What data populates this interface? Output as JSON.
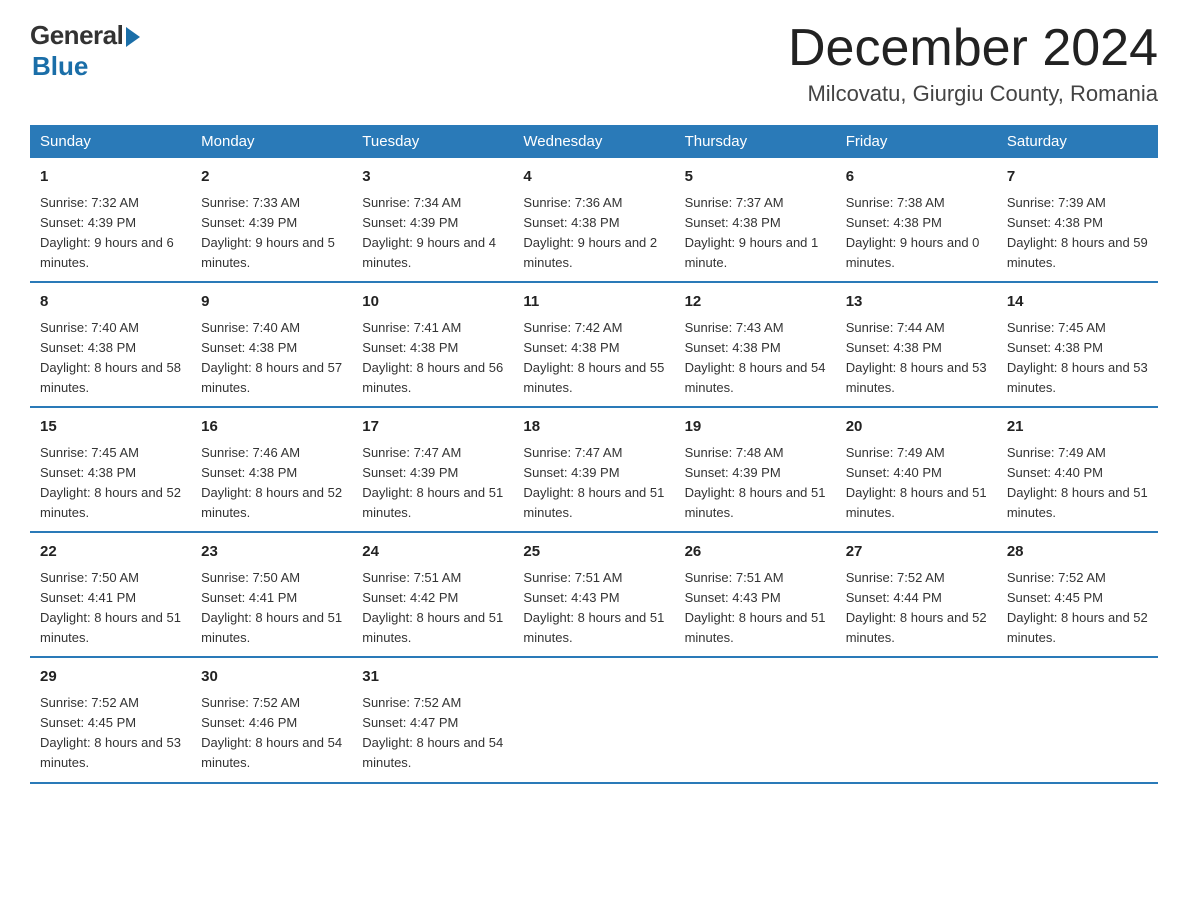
{
  "header": {
    "logo_general": "General",
    "logo_blue": "Blue",
    "month_title": "December 2024",
    "location": "Milcovatu, Giurgiu County, Romania"
  },
  "days_of_week": [
    "Sunday",
    "Monday",
    "Tuesday",
    "Wednesday",
    "Thursday",
    "Friday",
    "Saturday"
  ],
  "weeks": [
    [
      {
        "day": "1",
        "sunrise": "7:32 AM",
        "sunset": "4:39 PM",
        "daylight": "9 hours and 6 minutes."
      },
      {
        "day": "2",
        "sunrise": "7:33 AM",
        "sunset": "4:39 PM",
        "daylight": "9 hours and 5 minutes."
      },
      {
        "day": "3",
        "sunrise": "7:34 AM",
        "sunset": "4:39 PM",
        "daylight": "9 hours and 4 minutes."
      },
      {
        "day": "4",
        "sunrise": "7:36 AM",
        "sunset": "4:38 PM",
        "daylight": "9 hours and 2 minutes."
      },
      {
        "day": "5",
        "sunrise": "7:37 AM",
        "sunset": "4:38 PM",
        "daylight": "9 hours and 1 minute."
      },
      {
        "day": "6",
        "sunrise": "7:38 AM",
        "sunset": "4:38 PM",
        "daylight": "9 hours and 0 minutes."
      },
      {
        "day": "7",
        "sunrise": "7:39 AM",
        "sunset": "4:38 PM",
        "daylight": "8 hours and 59 minutes."
      }
    ],
    [
      {
        "day": "8",
        "sunrise": "7:40 AM",
        "sunset": "4:38 PM",
        "daylight": "8 hours and 58 minutes."
      },
      {
        "day": "9",
        "sunrise": "7:40 AM",
        "sunset": "4:38 PM",
        "daylight": "8 hours and 57 minutes."
      },
      {
        "day": "10",
        "sunrise": "7:41 AM",
        "sunset": "4:38 PM",
        "daylight": "8 hours and 56 minutes."
      },
      {
        "day": "11",
        "sunrise": "7:42 AM",
        "sunset": "4:38 PM",
        "daylight": "8 hours and 55 minutes."
      },
      {
        "day": "12",
        "sunrise": "7:43 AM",
        "sunset": "4:38 PM",
        "daylight": "8 hours and 54 minutes."
      },
      {
        "day": "13",
        "sunrise": "7:44 AM",
        "sunset": "4:38 PM",
        "daylight": "8 hours and 53 minutes."
      },
      {
        "day": "14",
        "sunrise": "7:45 AM",
        "sunset": "4:38 PM",
        "daylight": "8 hours and 53 minutes."
      }
    ],
    [
      {
        "day": "15",
        "sunrise": "7:45 AM",
        "sunset": "4:38 PM",
        "daylight": "8 hours and 52 minutes."
      },
      {
        "day": "16",
        "sunrise": "7:46 AM",
        "sunset": "4:38 PM",
        "daylight": "8 hours and 52 minutes."
      },
      {
        "day": "17",
        "sunrise": "7:47 AM",
        "sunset": "4:39 PM",
        "daylight": "8 hours and 51 minutes."
      },
      {
        "day": "18",
        "sunrise": "7:47 AM",
        "sunset": "4:39 PM",
        "daylight": "8 hours and 51 minutes."
      },
      {
        "day": "19",
        "sunrise": "7:48 AM",
        "sunset": "4:39 PM",
        "daylight": "8 hours and 51 minutes."
      },
      {
        "day": "20",
        "sunrise": "7:49 AM",
        "sunset": "4:40 PM",
        "daylight": "8 hours and 51 minutes."
      },
      {
        "day": "21",
        "sunrise": "7:49 AM",
        "sunset": "4:40 PM",
        "daylight": "8 hours and 51 minutes."
      }
    ],
    [
      {
        "day": "22",
        "sunrise": "7:50 AM",
        "sunset": "4:41 PM",
        "daylight": "8 hours and 51 minutes."
      },
      {
        "day": "23",
        "sunrise": "7:50 AM",
        "sunset": "4:41 PM",
        "daylight": "8 hours and 51 minutes."
      },
      {
        "day": "24",
        "sunrise": "7:51 AM",
        "sunset": "4:42 PM",
        "daylight": "8 hours and 51 minutes."
      },
      {
        "day": "25",
        "sunrise": "7:51 AM",
        "sunset": "4:43 PM",
        "daylight": "8 hours and 51 minutes."
      },
      {
        "day": "26",
        "sunrise": "7:51 AM",
        "sunset": "4:43 PM",
        "daylight": "8 hours and 51 minutes."
      },
      {
        "day": "27",
        "sunrise": "7:52 AM",
        "sunset": "4:44 PM",
        "daylight": "8 hours and 52 minutes."
      },
      {
        "day": "28",
        "sunrise": "7:52 AM",
        "sunset": "4:45 PM",
        "daylight": "8 hours and 52 minutes."
      }
    ],
    [
      {
        "day": "29",
        "sunrise": "7:52 AM",
        "sunset": "4:45 PM",
        "daylight": "8 hours and 53 minutes."
      },
      {
        "day": "30",
        "sunrise": "7:52 AM",
        "sunset": "4:46 PM",
        "daylight": "8 hours and 54 minutes."
      },
      {
        "day": "31",
        "sunrise": "7:52 AM",
        "sunset": "4:47 PM",
        "daylight": "8 hours and 54 minutes."
      },
      null,
      null,
      null,
      null
    ]
  ],
  "labels": {
    "sunrise": "Sunrise:",
    "sunset": "Sunset:",
    "daylight": "Daylight:"
  }
}
